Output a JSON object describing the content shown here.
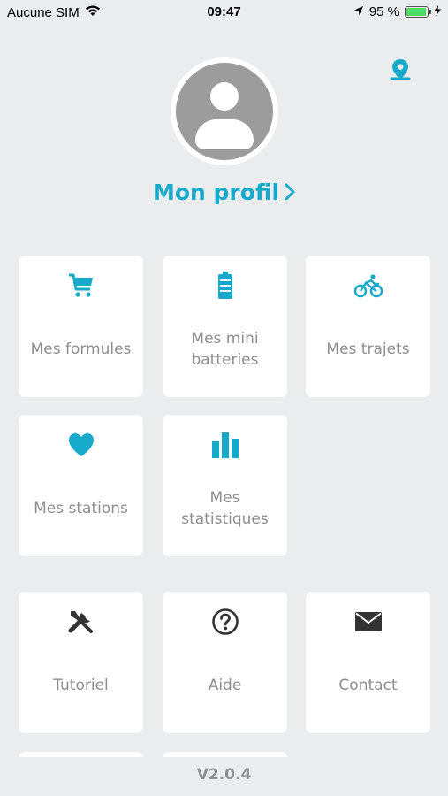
{
  "status_bar": {
    "carrier": "Aucune SIM",
    "time": "09:47",
    "battery_percent": "95 %",
    "battery_level": 0.95
  },
  "header": {
    "profile_label": "Mon profil",
    "profile_chevron": "›",
    "map_icon": "map-pin-icon"
  },
  "tiles": {
    "formules": {
      "label": "Mes formules",
      "icon": "cart-icon"
    },
    "batteries": {
      "label": "Mes mini\nbatteries",
      "icon": "battery-icon"
    },
    "trajets": {
      "label": "Mes trajets",
      "icon": "bike-icon"
    },
    "stations": {
      "label": "Mes stations",
      "icon": "heart-icon"
    },
    "statistiques": {
      "label": "Mes\nstatistiques",
      "icon": "bar-chart-icon"
    },
    "tutoriel": {
      "label": "Tutoriel",
      "icon": "tools-icon"
    },
    "aide": {
      "label": "Aide",
      "icon": "question-icon"
    },
    "contact": {
      "label": "Contact",
      "icon": "mail-icon"
    }
  },
  "footer": {
    "version": "V2.0.4"
  },
  "colors": {
    "accent": "#16a9c9",
    "background": "#ebecee",
    "tile": "#ffffff",
    "label": "#8e8e8e",
    "dark_icon": "#333333"
  }
}
